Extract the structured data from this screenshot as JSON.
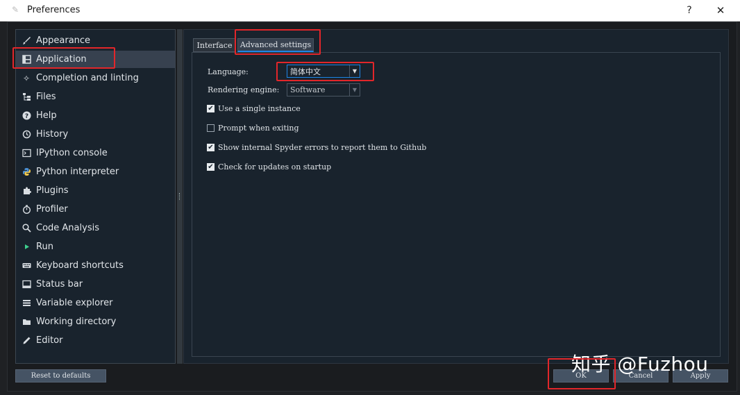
{
  "window": {
    "title": "Preferences",
    "help_label": "?",
    "close_label": "✕"
  },
  "sidebar": {
    "items": [
      {
        "label": "Appearance",
        "icon": "paintbrush-icon"
      },
      {
        "label": "Application",
        "icon": "layout-icon"
      },
      {
        "label": "Completion and linting",
        "icon": "sparkle-icon"
      },
      {
        "label": "Files",
        "icon": "file-tree-icon"
      },
      {
        "label": "Help",
        "icon": "help-circle-icon"
      },
      {
        "label": "History",
        "icon": "history-icon"
      },
      {
        "label": "IPython console",
        "icon": "terminal-icon"
      },
      {
        "label": "Python interpreter",
        "icon": "python-icon"
      },
      {
        "label": "Plugins",
        "icon": "puzzle-icon"
      },
      {
        "label": "Profiler",
        "icon": "stopwatch-icon"
      },
      {
        "label": "Code Analysis",
        "icon": "magnify-icon"
      },
      {
        "label": "Run",
        "icon": "play-icon"
      },
      {
        "label": "Keyboard shortcuts",
        "icon": "keyboard-icon"
      },
      {
        "label": "Status bar",
        "icon": "statusbar-icon"
      },
      {
        "label": "Variable explorer",
        "icon": "table-icon"
      },
      {
        "label": "Working directory",
        "icon": "folder-icon"
      },
      {
        "label": "Editor",
        "icon": "pencil-icon"
      }
    ],
    "selected": "Application"
  },
  "tabs": {
    "interface": "Interface",
    "advanced": "Advanced settings",
    "active": "Advanced settings"
  },
  "advanced": {
    "language_label": "Language:",
    "language_value": "简体中文",
    "rendering_label": "Rendering engine:",
    "rendering_value": "Software",
    "checkboxes": [
      {
        "label": "Use a single instance",
        "checked": true
      },
      {
        "label": "Prompt when exiting",
        "checked": false
      },
      {
        "label": "Show internal Spyder errors to report them to Github",
        "checked": true
      },
      {
        "label": "Check for updates on startup",
        "checked": true
      }
    ]
  },
  "buttons": {
    "reset": "Reset to defaults",
    "ok": "OK",
    "cancel": "Cancel",
    "apply": "Apply"
  },
  "watermark": "知乎 @Fuzhou",
  "colors": {
    "annotation": "#e3262a",
    "selected": "#37414f",
    "accent": "#1e86e8"
  }
}
